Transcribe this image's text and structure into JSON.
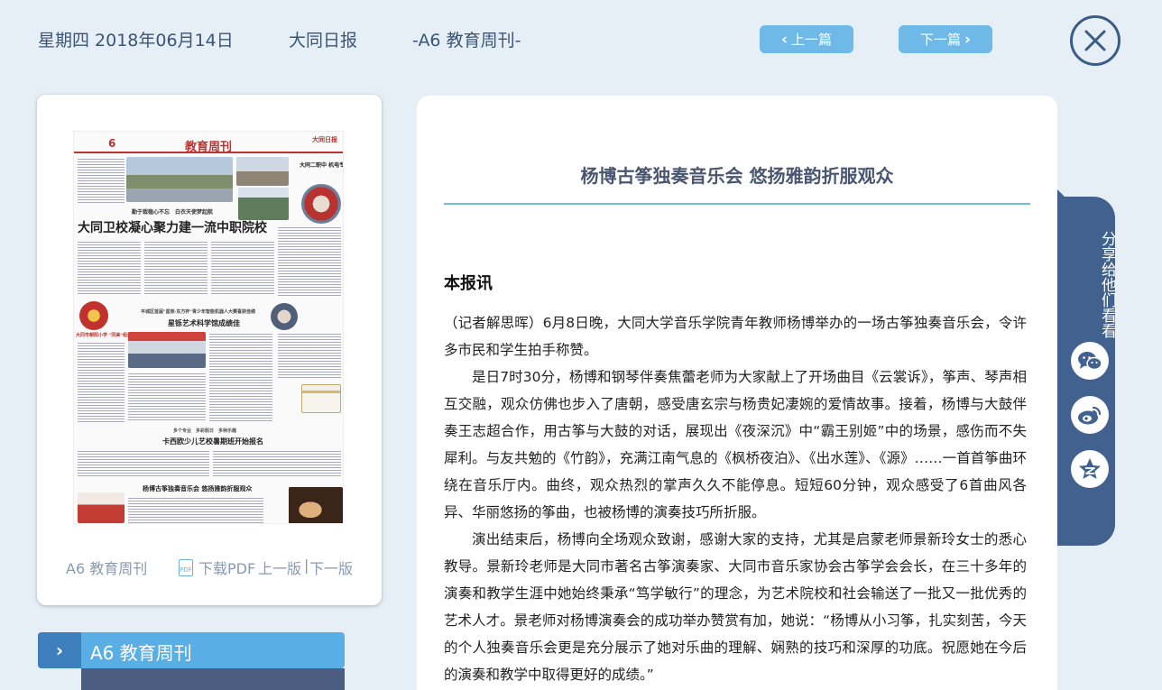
{
  "header": {
    "date": "星期四 2018年06月14日",
    "paper_name": "大同日报",
    "edition": "-A6 教育周刊-",
    "prev_label": "上一篇",
    "next_label": "下一篇"
  },
  "thumbnail": {
    "masthead": "教育周刊",
    "page_number": "6",
    "logo_text": "大同日报",
    "headline_main": "大同卫校凝心聚力建一流中职院校",
    "subhead_main": "勤于栽植心不忘　白衣天使梦起航",
    "side_head": "大同二职中 机电专业高作理想",
    "mid_head": "星铄艺术科学馆成绩佳",
    "mid_sub": "平城区首届\"星铄·东方杯\"青少年智能机器人大赛喜获佳绩",
    "lower_head": "卡西欧少儿艺校暑期班开始报名",
    "lower_sub": "多个专业　多彩假日　多种乐趣",
    "bottom_head": "杨博古筝独奏音乐会 悠扬雅韵折服观众",
    "left_box": "大同市朝阳小学 \"同美\"组建优化艺术节"
  },
  "card_footer": {
    "edition_label": "A6 教育周刊",
    "pdf_icon_text": "PDF",
    "download_label": "下载PDF",
    "prev_page": "上一版",
    "separator": "|",
    "next_page": "下一版"
  },
  "edition_tab": {
    "arrow": "›",
    "label": "A6  教育周刊"
  },
  "article": {
    "title": "杨博古筝独奏音乐会 悠扬雅韵折服观众",
    "section": "本报讯",
    "paragraphs": [
      "（记者解思晖）6月8日晚，大同大学音乐学院青年教师杨博举办的一场古筝独奏音乐会，令许多市民和学生拍手称赞。",
      "是日7时30分，杨博和钢琴伴奏焦蕾老师为大家献上了开场曲目《云裳诉》，筝声、琴声相互交融，观众仿佛也步入了唐朝，感受唐玄宗与杨贵妃凄婉的爱情故事。接着，杨博与大鼓伴奏王志超合作，用古筝与大鼓的对话，展现出《夜深沉》中“霸王别姬”中的场景，感伤而不失犀利。与友共勉的《竹韵》，充满江南气息的《枫桥夜泊》、《出水莲》、《源》……一首首筝曲环绕在音乐厅内。曲终，观众热烈的掌声久久不能停息。短短60分钟，观众感受了6首曲风各异、华丽悠扬的筝曲，也被杨博的演奏技巧所折服。",
      "演出结束后，杨博向全场观众致谢，感谢大家的支持，尤其是启蒙老师景新玲女士的悉心教导。景新玲老师是大同市著名古筝演奏家、大同市音乐家协会古筝学会会长，在三十多年的演奏和教学生涯中她始终秉承“笃学敏行”的理念，为艺术院校和社会输送了一批又一批优秀的艺术人才。景老师对杨博演奏会的成功举办赞赏有加，她说：“杨博从小习筝，扎实刻苦，今天的个人独奏音乐会更是充分展示了她对乐曲的理解、娴熟的技巧和深厚的功底。祝愿她在今后的演奏和教学中取得更好的成绩。”"
    ]
  },
  "share": {
    "label": "分享给他们看看",
    "icons": [
      "wechat-icon",
      "weibo-icon",
      "qzone-icon"
    ]
  },
  "colors": {
    "background": "#e6eef6",
    "accent": "#6eb9e8",
    "dark": "#41628f"
  }
}
